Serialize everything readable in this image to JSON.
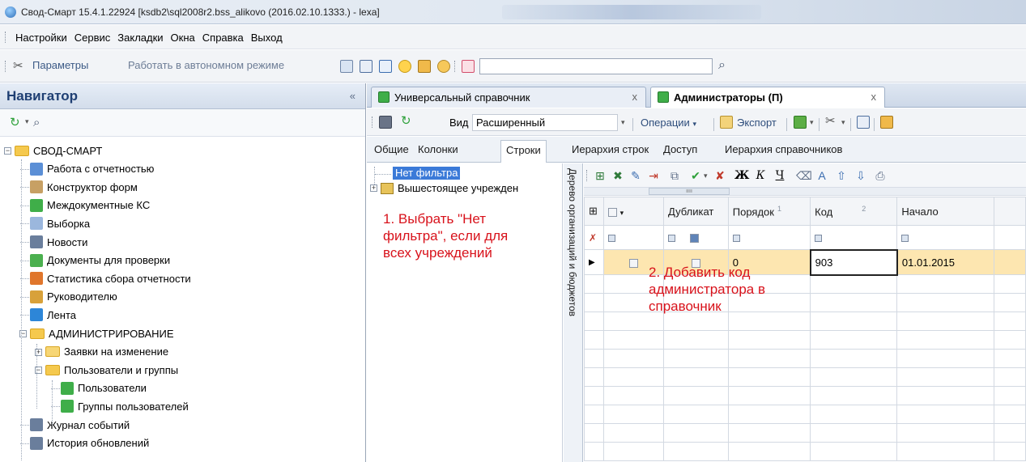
{
  "window": {
    "title": "Свод-Смарт 15.4.1.22924 [ksdb2\\sql2008r2.bss_alikovo (2016.02.10.1333.) - lexa]"
  },
  "menu": {
    "items": [
      "Настройки",
      "Сервис",
      "Закладки",
      "Окна",
      "Справка",
      "Выход"
    ]
  },
  "toolbar": {
    "params_label": "Параметры",
    "offline_label": "Работать в автономном режиме",
    "search_value": ""
  },
  "navigator": {
    "title": "Навигатор",
    "collapse_glyph": "«",
    "tree": [
      {
        "label": "СВОД-СМАРТ",
        "icon": "folder-open-icon"
      },
      {
        "label": "Работа с отчетностью",
        "icon": "report-icon"
      },
      {
        "label": "Конструктор форм",
        "icon": "form-designer-icon"
      },
      {
        "label": "Междокументные КС",
        "icon": "green-table-icon"
      },
      {
        "label": "Выборка",
        "icon": "selection-icon"
      },
      {
        "label": "Новости",
        "icon": "news-icon"
      },
      {
        "label": "Документы для проверки",
        "icon": "check-document-icon"
      },
      {
        "label": "Статистика сбора отчетности",
        "icon": "statistics-icon"
      },
      {
        "label": "Руководителю",
        "icon": "manager-icon"
      },
      {
        "label": "Лента",
        "icon": "feed-icon"
      },
      {
        "label": "АДМИНИСТРИРОВАНИЕ",
        "icon": "folder-open-icon"
      },
      {
        "label": "Заявки на изменение",
        "icon": "folder-icon"
      },
      {
        "label": "Пользователи и группы",
        "icon": "folder-open-icon"
      },
      {
        "label": "Пользователи",
        "icon": "green-table-icon"
      },
      {
        "label": "Группы пользователей",
        "icon": "green-table-icon"
      },
      {
        "label": "Журнал событий",
        "icon": "journal-icon"
      },
      {
        "label": "История обновлений",
        "icon": "history-icon"
      }
    ]
  },
  "doc_tabs": [
    {
      "label": "Универсальный справочник",
      "close": "x"
    },
    {
      "label": "Администраторы (П)",
      "close": "x"
    }
  ],
  "sub_toolbar": {
    "view_label": "Вид",
    "view_value": "Расширенный",
    "operations_label": "Операции",
    "export_label": "Экспорт"
  },
  "inner_tabs": [
    "Общие",
    "Колонки",
    "Строки",
    "Иерархия строк",
    "Доступ",
    "Иерархия справочников"
  ],
  "filter_pane": {
    "selected_item": "Нет фильтра",
    "item2": "Вышестоящее учрежден",
    "annotation1": [
      "1. Выбрать \"Нет",
      "фильтра\", если для",
      "всех учреждений"
    ]
  },
  "side_strip": {
    "label": "Дерево организаций и бюджетов"
  },
  "grid": {
    "format_buttons": [
      "Ж",
      "К",
      "Ч"
    ],
    "headers": [
      "Дубликат",
      "Порядок",
      "Код",
      "Начало"
    ],
    "sort_markers": [
      "1",
      "2"
    ],
    "row": {
      "order": "0",
      "code": "903",
      "start": "01.01.2015"
    },
    "annotation2": [
      "2. Добавить код",
      "администратора в",
      "справочник"
    ]
  },
  "colors": {
    "accent": "#1f3f73",
    "selection": "#3b7ad8",
    "selected_row": "#fde6b0",
    "annotation": "#d8121b"
  }
}
